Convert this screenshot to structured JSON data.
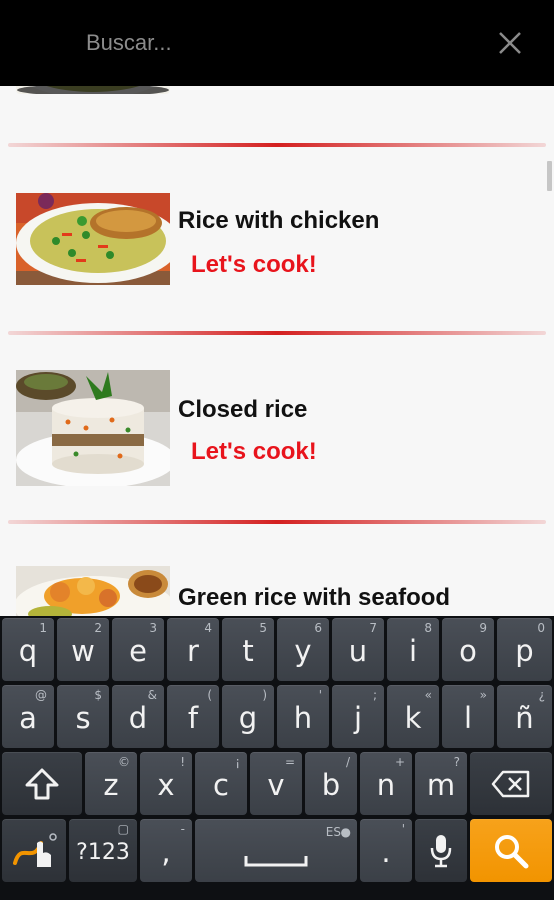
{
  "search": {
    "placeholder": "Buscar..."
  },
  "recipes": [
    {
      "title": "Rice with chicken",
      "action": "Let's cook!"
    },
    {
      "title": "Closed rice",
      "action": "Let's cook!"
    },
    {
      "title": "Green rice with seafood",
      "action": ""
    }
  ],
  "keyboard": {
    "row1": [
      {
        "label": "q",
        "hint": "1"
      },
      {
        "label": "w",
        "hint": "2"
      },
      {
        "label": "e",
        "hint": "3"
      },
      {
        "label": "r",
        "hint": "4"
      },
      {
        "label": "t",
        "hint": "5"
      },
      {
        "label": "y",
        "hint": "6"
      },
      {
        "label": "u",
        "hint": "7"
      },
      {
        "label": "i",
        "hint": "8"
      },
      {
        "label": "o",
        "hint": "9"
      },
      {
        "label": "p",
        "hint": "0"
      }
    ],
    "row2": [
      {
        "label": "a",
        "hint": "@"
      },
      {
        "label": "s",
        "hint": "$"
      },
      {
        "label": "d",
        "hint": "&"
      },
      {
        "label": "f",
        "hint": "("
      },
      {
        "label": "g",
        "hint": ")"
      },
      {
        "label": "h",
        "hint": "'"
      },
      {
        "label": "j",
        "hint": ";"
      },
      {
        "label": "k",
        "hint": "«"
      },
      {
        "label": "l",
        "hint": "»"
      },
      {
        "label": "ñ",
        "hint": "¿"
      }
    ],
    "row3": [
      {
        "label": "z",
        "hint": "©"
      },
      {
        "label": "x",
        "hint": "!"
      },
      {
        "label": "c",
        "hint": "¡"
      },
      {
        "label": "v",
        "hint": "="
      },
      {
        "label": "b",
        "hint": "/"
      },
      {
        "label": "n",
        "hint": "+"
      },
      {
        "label": "m",
        "hint": "?"
      }
    ],
    "symbols_label": "?123",
    "comma_label": ",",
    "comma_hint": "-",
    "language_label": "ES",
    "period_label": ".",
    "period_hint": "'"
  },
  "icons": {
    "close": "close-icon",
    "shift": "shift-icon",
    "backspace": "backspace-icon",
    "swype": "swype-icon",
    "mic": "microphone-icon",
    "search": "search-icon"
  },
  "colors": {
    "accent_red": "#e8141c",
    "search_key": "#f29400"
  }
}
